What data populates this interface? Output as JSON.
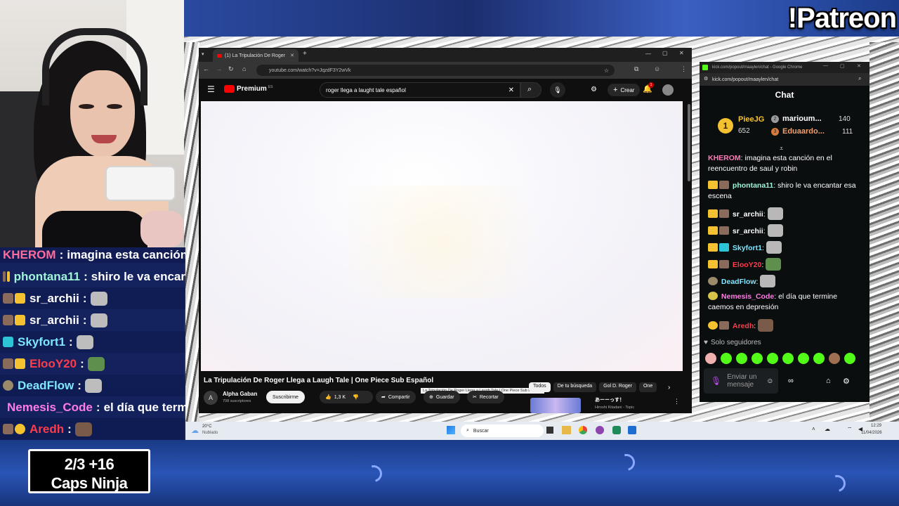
{
  "overlay": {
    "patreon": "!Patreon",
    "caps": {
      "line1": "2/3   +16",
      "line2": "Caps Ninja"
    },
    "chat": [
      {
        "user": "KHEROM",
        "color": "#ff6b9a",
        "msg": "imagina esta canción e"
      },
      {
        "user": "phontana11",
        "color": "#9ff5d8",
        "msg": "shiro le va encar"
      },
      {
        "user": "sr_archii",
        "color": "#ffffff",
        "msg": ""
      },
      {
        "user": "sr_archii",
        "color": "#ffffff",
        "msg": ""
      },
      {
        "user": "Skyfort1",
        "color": "#7ee6ff",
        "msg": ""
      },
      {
        "user": "ElooY20",
        "color": "#ff3b4a",
        "msg": ""
      },
      {
        "user": "DeadFlow",
        "color": "#7ee6ff",
        "msg": ""
      },
      {
        "user": "Nemesis_Code",
        "color": "#ff7be5",
        "msg": "el día que term"
      },
      {
        "user": "Aredh",
        "color": "#ff3b4a",
        "msg": ""
      }
    ],
    "separator": ":"
  },
  "youtube": {
    "tab_title": "(1) La Tripulación De Roger",
    "url": "youtube.com/watch?v=JqzdF3Y2wVk",
    "logo": "Premium",
    "logo_sup": "ES",
    "search_query": "roger llega a laught tale español",
    "create_label": "Crear",
    "notif_count": "1",
    "video_title": "La Tripulación De Roger Llega a Laugh Tale | One Piece Sub Español",
    "tooltip": "La Tripulación De Roger Llega a Laugh Tale | One Piece Sub Español",
    "channel": "Alpha Gaban",
    "channel_initial": "A",
    "subs": "708 suscriptores",
    "subscribe": "Suscribirme",
    "likes": "1,3 K",
    "share": "Compartir",
    "save": "Guardar",
    "clip": "Recortar",
    "chips": [
      "Todos",
      "De tu búsqueda",
      "Gol D. Roger",
      "One"
    ],
    "rec_title": "あーーっす！",
    "rec_channel": "Hiroshi Kitadani - Topic"
  },
  "taskbar": {
    "weather_temp": "20°C",
    "weather_desc": "Nublado",
    "search": "Buscar",
    "time": "12:29",
    "date": "11/04/2026"
  },
  "kick": {
    "window_title": "kick.com/popout/maaylen/chat - Google Chrome",
    "url": "kick.com/popout/maaylen/chat",
    "header": "Chat",
    "leaders": [
      {
        "rank": "1",
        "name": "PieeJG",
        "score": "652"
      },
      {
        "rank": "2",
        "name": "marioum...",
        "score": "140"
      },
      {
        "rank": "3",
        "name": "Eduaardo...",
        "score": "111"
      }
    ],
    "messages": [
      {
        "user": "KHEROM",
        "color": "#ff7ab8",
        "text": "imagina esta canción en el reencuentro de saul y robin"
      },
      {
        "user": "phontana11",
        "color": "#9ff5d8",
        "text": "shiro le va encantar esa escena"
      },
      {
        "user": "sr_archii",
        "color": "#ffffff",
        "text": ""
      },
      {
        "user": "sr_archii",
        "color": "#ffffff",
        "text": ""
      },
      {
        "user": "Skyfort1",
        "color": "#7ee6ff",
        "text": ""
      },
      {
        "user": "ElooY20",
        "color": "#ff3b4a",
        "text": ""
      },
      {
        "user": "DeadFlow",
        "color": "#7ee6ff",
        "text": ""
      },
      {
        "user": "Nemesis_Code",
        "color": "#ff7be5",
        "text": "el día que termine caemos en depresión"
      },
      {
        "user": "Aredh",
        "color": "#ff3b4a",
        "text": ""
      }
    ],
    "followers_only": "Solo seguidores",
    "send_placeholder": "Enviar un mensaje",
    "colon": ":"
  }
}
